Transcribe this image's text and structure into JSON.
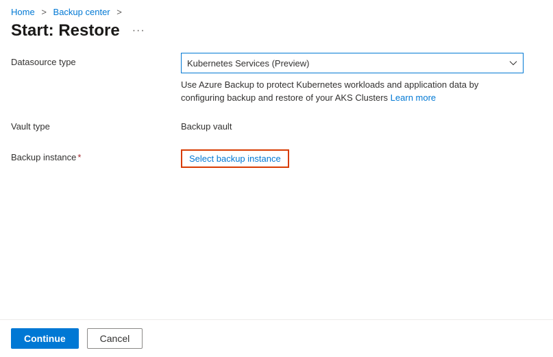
{
  "breadcrumb": {
    "items": [
      {
        "label": "Home"
      },
      {
        "label": "Backup center"
      }
    ]
  },
  "header": {
    "title": "Start: Restore"
  },
  "form": {
    "datasource": {
      "label": "Datasource type",
      "selected": "Kubernetes Services (Preview)",
      "help_text": "Use Azure Backup to protect Kubernetes workloads and application data by configuring backup and restore of your AKS Clusters ",
      "learn_more": "Learn more"
    },
    "vault": {
      "label": "Vault type",
      "value": "Backup vault"
    },
    "instance": {
      "label": "Backup instance",
      "link": "Select backup instance"
    }
  },
  "footer": {
    "continue": "Continue",
    "cancel": "Cancel"
  }
}
